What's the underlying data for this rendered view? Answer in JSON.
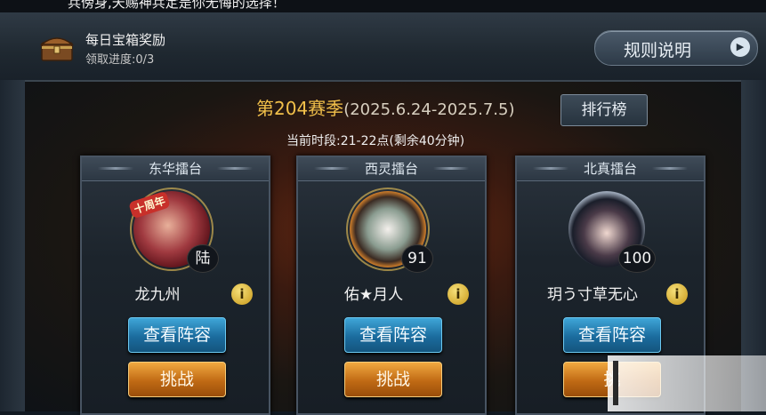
{
  "top_banner": {
    "text": "兵傍身,天赐神兵定是你无悔的选择！"
  },
  "daily_chest": {
    "title": "每日宝箱奖励",
    "progress": "领取进度:0/3",
    "icon": "treasure-chest-icon"
  },
  "rules_button": {
    "label": "规则说明",
    "icon": "play-arrow-icon"
  },
  "season": {
    "name": "第204赛季",
    "dates": "(2025.6.24-2025.7.5)",
    "period": "当前时段:21-22点(剩余40分钟)"
  },
  "ranking_button": {
    "label": "排行榜"
  },
  "arenas": [
    {
      "title": "东华擂台",
      "player": "龙九州",
      "level": "陆",
      "badge": "十周年",
      "view_label": "查看阵容",
      "challenge_label": "挑战"
    },
    {
      "title": "西灵擂台",
      "player": "佑★月人",
      "level": "91",
      "view_label": "查看阵容",
      "challenge_label": "挑战"
    },
    {
      "title": "北真擂台",
      "player": "玥う寸草无心",
      "level": "100",
      "view_label": "查看阵容",
      "challenge_label": "挑"
    }
  ],
  "info_icon_glyph": "i",
  "colors": {
    "season_gold": "#f2c04a",
    "view_button_blue": "#1b6c9e",
    "challenge_button_orange": "#c06a14",
    "panel_dark": "#1c242c"
  }
}
